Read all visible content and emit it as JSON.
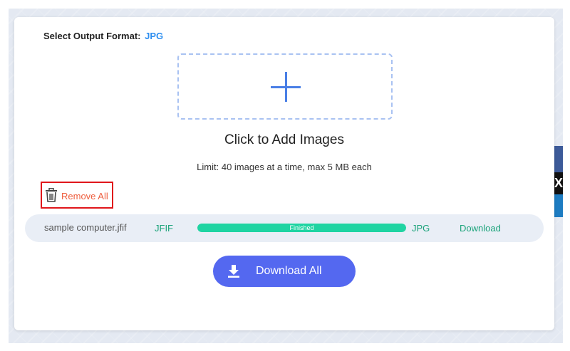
{
  "header": {
    "format_label": "Select Output Format:",
    "format_value": "JPG"
  },
  "upload": {
    "icon": "plus-icon",
    "title": "Click to Add Images",
    "limit_text": "Limit: 40 images at a time, max 5 MB each"
  },
  "actions": {
    "remove_all_icon": "trash-icon",
    "remove_all_label": "Remove All",
    "download_all_icon": "download-icon",
    "download_all_label": "Download All"
  },
  "files": [
    {
      "name": "sample computer.jfif",
      "source_format": "JFIF",
      "status": "Finished",
      "progress_fraction": 1.0,
      "target_format": "JPG",
      "action_label": "Download"
    }
  ],
  "side_widget": {
    "glyph": "X"
  },
  "colors": {
    "accent_blue": "#2f8ff0",
    "primary_button": "#5468f0",
    "success_green": "#1aa37a",
    "progress_fill": "#1fd4a2",
    "remove_orange": "#ee5e3e",
    "highlight_red": "#e0161b"
  }
}
